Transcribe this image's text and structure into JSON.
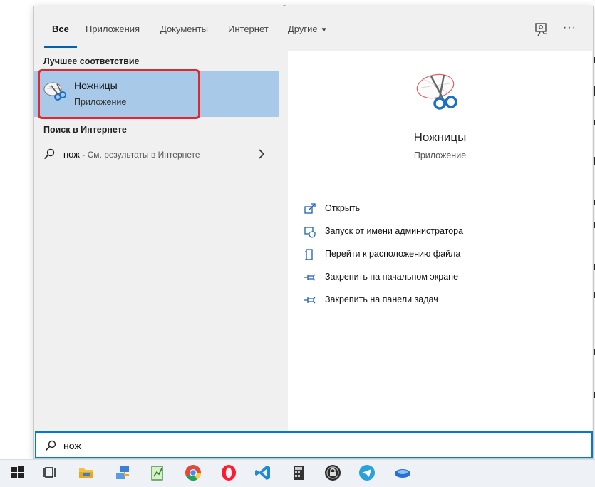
{
  "tabs": {
    "all": "Все",
    "apps": "Приложения",
    "docs": "Документы",
    "web": "Интернет",
    "other": "Другие"
  },
  "icons": {
    "feedback": "feedback-icon",
    "more": "more-options-icon",
    "more_glyph": "···"
  },
  "left": {
    "best_match_title": "Лучшее соответствие",
    "best_match": {
      "name": "Ножницы",
      "type": "Приложение"
    },
    "web_title": "Поиск в Интернете",
    "web_query": "нож",
    "web_hint": " - См. результаты в Интернете"
  },
  "detail": {
    "name": "Ножницы",
    "type": "Приложение",
    "actions": [
      {
        "label": "Открыть",
        "icon": "open-icon"
      },
      {
        "label": "Запуск от имени администратора",
        "icon": "admin-shield-icon"
      },
      {
        "label": "Перейти к расположению файла",
        "icon": "file-location-icon"
      },
      {
        "label": "Закрепить на начальном экране",
        "icon": "pin-icon"
      },
      {
        "label": "Закрепить на панели задач",
        "icon": "pin-icon"
      }
    ]
  },
  "search": {
    "value": "нож"
  },
  "taskbar": {
    "apps": [
      "windows-start-icon",
      "task-view-icon",
      "file-explorer-icon",
      "network-icon",
      "notepad-icon",
      "chrome-icon",
      "opera-icon",
      "vscode-icon",
      "calculator-icon",
      "lock-app-icon",
      "telegram-icon",
      "snipping-app-icon"
    ]
  },
  "colors": {
    "accent": "#0078d7",
    "selection": "#a9c9e8",
    "highlight_border": "#e2262b"
  }
}
